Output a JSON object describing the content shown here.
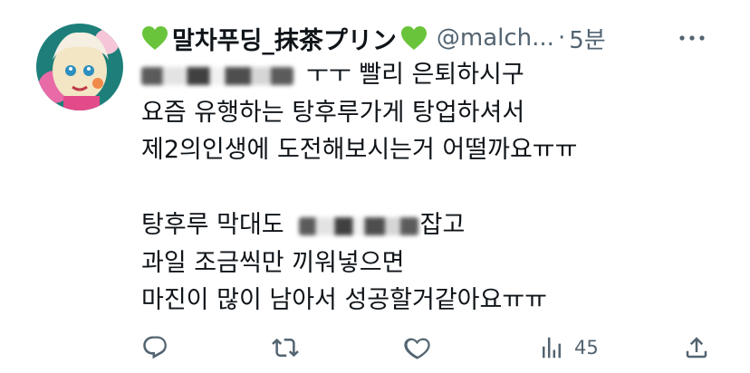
{
  "tweet": {
    "display_name": "말차푸딩_抹茶プリン",
    "handle": "@malch...",
    "separator": "·",
    "time": "5분",
    "lines": [
      {
        "before": "",
        "after": "ㅜㅜ 빨리 은퇴하시구",
        "blurred": true
      },
      {
        "before": "요즘 유행하는 탕후루가게 탕업하셔서",
        "after": "",
        "blurred": false
      },
      {
        "before": "제2의인생에 도전해보시는거 어떨까요ㅠㅠ",
        "after": "",
        "blurred": false
      },
      {
        "before": "",
        "after": "",
        "blurred": false
      },
      {
        "before": "탕후루 막대도",
        "after": "잡고",
        "blurred": true
      },
      {
        "before": "과일 조금씩만 끼워넣으면",
        "after": "",
        "blurred": false
      },
      {
        "before": "마진이 많이 남아서 성공할거같아요ㅠㅠ",
        "after": "",
        "blurred": false
      }
    ],
    "views": "45"
  },
  "icons": {
    "heart_emoji": "green-heart-icon",
    "more": "more-icon",
    "reply": "reply-icon",
    "retweet": "retweet-icon",
    "like": "like-icon",
    "views": "views-icon",
    "share": "share-icon"
  },
  "colors": {
    "text": "#0f1419",
    "secondary": "#536471",
    "heart_green": "#6ac43b"
  }
}
